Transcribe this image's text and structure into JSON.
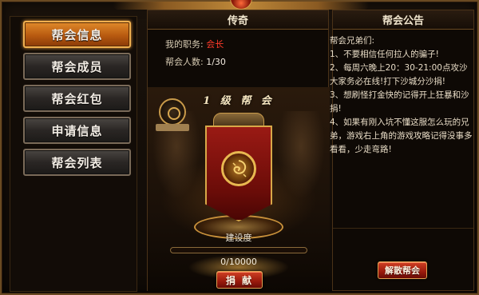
{
  "nav": {
    "items": [
      {
        "label": "帮会信息",
        "active": true
      },
      {
        "label": "帮会成员",
        "active": false
      },
      {
        "label": "帮会红包",
        "active": false
      },
      {
        "label": "申请信息",
        "active": false
      },
      {
        "label": "帮会列表",
        "active": false
      }
    ]
  },
  "guild": {
    "name": "传奇",
    "position_label": "我的职务:",
    "position_value": "会长",
    "members_label": "帮会人数:",
    "members_value": "1/30",
    "level_text": "1 级 帮 会",
    "construction_label": "建设度",
    "construction_progress": "0/10000",
    "construction_fraction": 0,
    "donate_button": "捐 献"
  },
  "notice": {
    "title": "帮会公告",
    "lines": [
      "帮会兄弟们:",
      "1、不要相信任何拉人的骗子!",
      "2、每周六晚上20：30-21:00点攻沙大家务必在线!打下沙城分沙捐!",
      "3、想刷怪打金快的记得开上狂暴和沙捐!",
      "4、如果有刚入坑不懂这服怎么玩的兄弟，游戏右上角的游戏攻略记得没事多看看，少走弯路!"
    ],
    "disband_button": "解散帮会"
  },
  "colors": {
    "accent": "#f0b050",
    "red": "#ff3a2a"
  }
}
